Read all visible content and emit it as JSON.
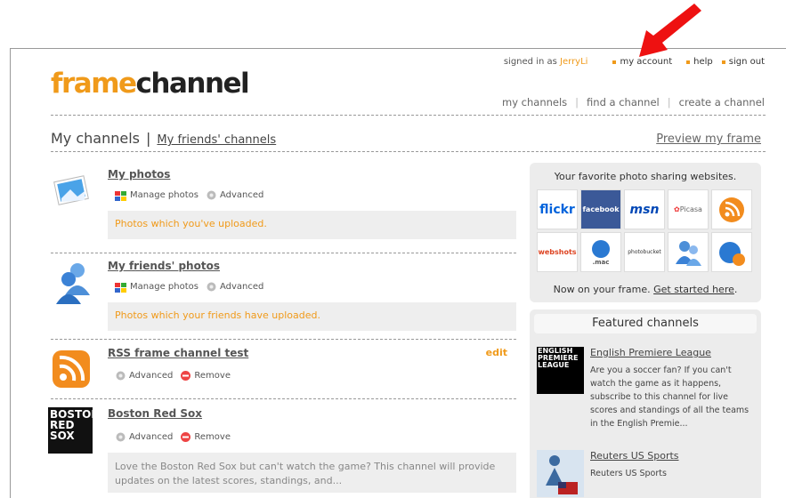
{
  "brand": {
    "part1": "frame",
    "part2": "channel"
  },
  "userbar": {
    "signed_in_prefix": "signed in as",
    "username": "JerryLi",
    "links": [
      "my account",
      "help",
      "sign out"
    ]
  },
  "mainnav": [
    "my channels",
    "find a channel",
    "create a channel"
  ],
  "tabs": {
    "active": "My channels",
    "separator": "|",
    "other": "My friends' channels"
  },
  "preview_link": "Preview my frame",
  "channels": [
    {
      "title": "My photos",
      "actions": [
        "Manage photos",
        "Advanced"
      ],
      "desc": "Photos which you've uploaded."
    },
    {
      "title": "My friends' photos",
      "actions": [
        "Manage photos",
        "Advanced"
      ],
      "desc": "Photos which your friends have uploaded."
    },
    {
      "title": "RSS frame channel test",
      "edit": "edit",
      "actions": [
        "Advanced",
        "Remove"
      ]
    },
    {
      "title": "Boston Red Sox",
      "thumb_text": "BOSTON RED SOX",
      "actions": [
        "Advanced",
        "Remove"
      ],
      "desc": "Love the Boston Red Sox but can't watch the game? This channel will provide updates on the latest scores, standings, and..."
    }
  ],
  "photo_sites": {
    "heading": "Your favorite photo sharing websites.",
    "tiles": [
      "flickr",
      "facebook",
      "msn",
      "Picasa",
      "rss",
      "webshots",
      ".mac",
      "photobucket",
      "users",
      "globe-rss"
    ],
    "footer_prefix": "Now on your frame.",
    "footer_link": "Get started here"
  },
  "featured": {
    "heading": "Featured channels",
    "items": [
      {
        "title": "English Premiere League",
        "thumb_text": "ENGLISH PREMIERE LEAGUE",
        "desc": "Are you a soccer fan? If you can't watch the game as it happens, subscribe to this channel for live scores and standings of all the teams in the English Premie..."
      },
      {
        "title": "Reuters US Sports",
        "desc": "Reuters US Sports"
      }
    ]
  },
  "colors": {
    "accent": "#f09a1a",
    "arrow": "#ee1111",
    "facebook": "#3b5998"
  }
}
